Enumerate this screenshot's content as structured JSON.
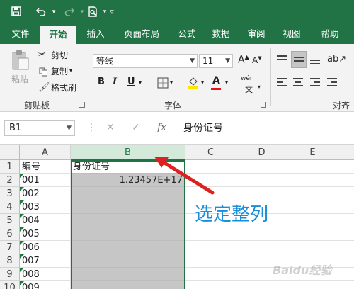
{
  "menu": {
    "tabs": [
      "文件",
      "开始",
      "插入",
      "页面布局",
      "公式",
      "数据",
      "审阅",
      "视图",
      "帮助"
    ],
    "active_tab": "开始"
  },
  "ribbon": {
    "clipboard": {
      "paste": "粘贴",
      "cut": "剪切",
      "copy": "复制",
      "format_painter": "格式刷",
      "group_label": "剪贴板"
    },
    "font": {
      "font_name": "等线",
      "font_size": "11",
      "bold": "B",
      "italic": "I",
      "underline": "U",
      "group_label": "字体",
      "phonetic": "wén"
    },
    "alignment": {
      "group_label": "对齐方"
    }
  },
  "formula_bar": {
    "name_box": "B1",
    "fx": "fx",
    "content": "身份证号"
  },
  "grid": {
    "columns": [
      "A",
      "B",
      "C",
      "D",
      "E"
    ],
    "selected_column": "B",
    "rows": [
      {
        "num": "1",
        "a": "编号",
        "b": "身份证号"
      },
      {
        "num": "2",
        "a": "001",
        "b": "1.23457E+17"
      },
      {
        "num": "3",
        "a": "002",
        "b": ""
      },
      {
        "num": "4",
        "a": "003",
        "b": ""
      },
      {
        "num": "5",
        "a": "004",
        "b": ""
      },
      {
        "num": "6",
        "a": "005",
        "b": ""
      },
      {
        "num": "7",
        "a": "006",
        "b": ""
      },
      {
        "num": "8",
        "a": "007",
        "b": ""
      },
      {
        "num": "9",
        "a": "008",
        "b": ""
      },
      {
        "num": "10",
        "a": "009",
        "b": ""
      }
    ]
  },
  "annotation": {
    "text": "选定整列",
    "color": "#1a8ed8",
    "arrow_color": "#e02020"
  },
  "watermark": "Baidu经验",
  "colors": {
    "excel_green": "#217346",
    "selection_fill": "#c6c6c6"
  }
}
